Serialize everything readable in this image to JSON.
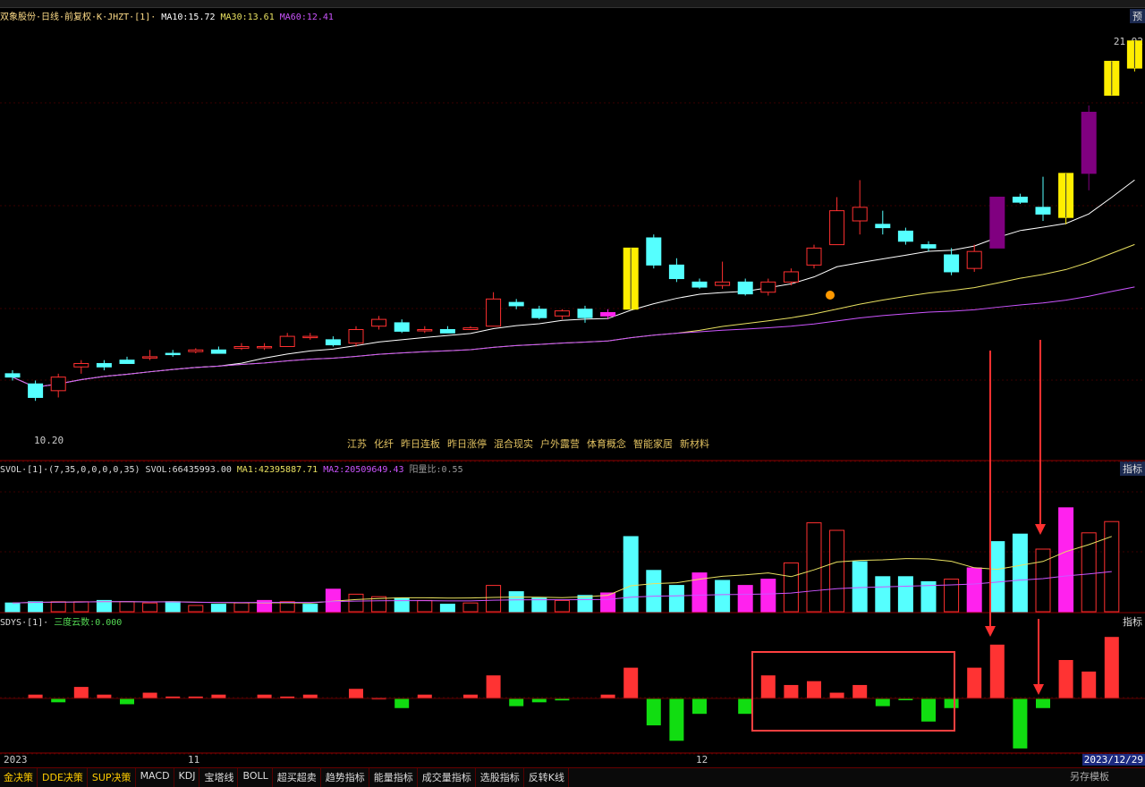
{
  "main_header": {
    "title": "双象股份·日线·前复权·K·JHZT·[1]·",
    "ma10": "MA10:15.72",
    "ma30": "MA30:13.61",
    "ma60": "MA60:12.41",
    "max_price": "21.92",
    "min_price": "10.20",
    "right_tag": "预"
  },
  "vol_header": {
    "title": "SVOL·[1]·(7,35,0,0,0,0,35)",
    "svol": "SVOL:66435993.00",
    "ma1": "MA1:42395887.71",
    "ma2": "MA2:20509649.43",
    "ratio": "阳量比:0.55",
    "right_tag": "指标"
  },
  "sdys_header": {
    "title": "SDYS·[1]·",
    "value": "三度云数:0.000",
    "right_tag": "指标"
  },
  "concepts": [
    "江苏",
    "化纤",
    "昨日连板",
    "昨日涨停",
    "混合现实",
    "户外露营",
    "体育概念",
    "智能家居",
    "新材料"
  ],
  "time_axis": {
    "year": "2023",
    "m11": "11",
    "m12": "12",
    "current_date": "2023/12/29"
  },
  "tabs": [
    "金决策",
    "DDE决策",
    "SUP决策",
    "MACD",
    "KDJ",
    "宝塔线",
    "BOLL",
    "超买超卖",
    "趋势指标",
    "能量指标",
    "成交量指标",
    "选股指标",
    "反转K线"
  ],
  "save_label": "另存模板",
  "colors": {
    "up": "#ff3030",
    "down": "#55ffff",
    "magenta": "#ff22ee",
    "yellow": "#ffee00",
    "purple": "#800080",
    "ma10": "#ffffff",
    "ma30": "#e8e060",
    "ma60": "#cc55ff",
    "arrow": "#ff3030"
  },
  "chart_data": {
    "type": "candlestick",
    "candles": [
      {
        "o": 12.1,
        "h": 12.2,
        "l": 11.9,
        "c": 12.0,
        "t": "down"
      },
      {
        "o": 11.8,
        "h": 11.9,
        "l": 11.3,
        "c": 11.4,
        "t": "down"
      },
      {
        "o": 11.6,
        "h": 12.1,
        "l": 11.4,
        "c": 12.0,
        "t": "up"
      },
      {
        "o": 12.4,
        "h": 12.5,
        "l": 12.1,
        "c": 12.3,
        "t": "up"
      },
      {
        "o": 12.3,
        "h": 12.5,
        "l": 12.2,
        "c": 12.4,
        "t": "down"
      },
      {
        "o": 12.5,
        "h": 12.6,
        "l": 12.4,
        "c": 12.4,
        "t": "down"
      },
      {
        "o": 12.6,
        "h": 12.8,
        "l": 12.5,
        "c": 12.6,
        "t": "up"
      },
      {
        "o": 12.7,
        "h": 12.8,
        "l": 12.6,
        "c": 12.7,
        "t": "down"
      },
      {
        "o": 12.8,
        "h": 12.85,
        "l": 12.7,
        "c": 12.75,
        "t": "up"
      },
      {
        "o": 12.8,
        "h": 12.9,
        "l": 12.7,
        "c": 12.7,
        "t": "down"
      },
      {
        "o": 12.9,
        "h": 13.0,
        "l": 12.8,
        "c": 12.85,
        "t": "up"
      },
      {
        "o": 12.9,
        "h": 13.0,
        "l": 12.8,
        "c": 12.9,
        "t": "up"
      },
      {
        "o": 12.9,
        "h": 13.3,
        "l": 12.9,
        "c": 13.2,
        "t": "up"
      },
      {
        "o": 13.2,
        "h": 13.3,
        "l": 13.1,
        "c": 13.2,
        "t": "up"
      },
      {
        "o": 13.1,
        "h": 13.2,
        "l": 12.9,
        "c": 12.95,
        "t": "down"
      },
      {
        "o": 13.0,
        "h": 13.5,
        "l": 12.9,
        "c": 13.4,
        "t": "up"
      },
      {
        "o": 13.5,
        "h": 13.8,
        "l": 13.4,
        "c": 13.7,
        "t": "up"
      },
      {
        "o": 13.6,
        "h": 13.7,
        "l": 13.3,
        "c": 13.35,
        "t": "down"
      },
      {
        "o": 13.4,
        "h": 13.5,
        "l": 13.3,
        "c": 13.4,
        "t": "up"
      },
      {
        "o": 13.4,
        "h": 13.5,
        "l": 13.3,
        "c": 13.3,
        "t": "down"
      },
      {
        "o": 13.4,
        "h": 13.5,
        "l": 13.4,
        "c": 13.45,
        "t": "up"
      },
      {
        "o": 13.5,
        "h": 14.5,
        "l": 13.5,
        "c": 14.3,
        "t": "up"
      },
      {
        "o": 14.2,
        "h": 14.3,
        "l": 14.0,
        "c": 14.1,
        "t": "down"
      },
      {
        "o": 14.0,
        "h": 14.1,
        "l": 13.7,
        "c": 13.75,
        "t": "down"
      },
      {
        "o": 13.8,
        "h": 14.0,
        "l": 13.7,
        "c": 13.95,
        "t": "up"
      },
      {
        "o": 14.0,
        "h": 14.1,
        "l": 13.6,
        "c": 13.75,
        "t": "down"
      },
      {
        "o": 13.8,
        "h": 14.0,
        "l": 13.7,
        "c": 13.9,
        "t": "magenta"
      },
      {
        "o": 14.0,
        "h": 15.8,
        "l": 14.0,
        "c": 15.8,
        "t": "yellow"
      },
      {
        "o": 16.1,
        "h": 16.2,
        "l": 15.2,
        "c": 15.3,
        "t": "down"
      },
      {
        "o": 15.3,
        "h": 15.5,
        "l": 14.8,
        "c": 14.9,
        "t": "down"
      },
      {
        "o": 14.8,
        "h": 14.9,
        "l": 14.6,
        "c": 14.65,
        "t": "down"
      },
      {
        "o": 14.7,
        "h": 15.4,
        "l": 14.6,
        "c": 14.8,
        "t": "up"
      },
      {
        "o": 14.8,
        "h": 14.9,
        "l": 14.4,
        "c": 14.45,
        "t": "down"
      },
      {
        "o": 14.5,
        "h": 14.9,
        "l": 14.4,
        "c": 14.8,
        "t": "up"
      },
      {
        "o": 14.8,
        "h": 15.2,
        "l": 14.7,
        "c": 15.1,
        "t": "up"
      },
      {
        "o": 15.3,
        "h": 15.9,
        "l": 15.2,
        "c": 15.8,
        "t": "up"
      },
      {
        "o": 15.9,
        "h": 17.3,
        "l": 15.9,
        "c": 16.9,
        "t": "up"
      },
      {
        "o": 16.6,
        "h": 17.8,
        "l": 16.2,
        "c": 17.0,
        "t": "up"
      },
      {
        "o": 16.5,
        "h": 16.9,
        "l": 16.2,
        "c": 16.4,
        "t": "down"
      },
      {
        "o": 16.3,
        "h": 16.4,
        "l": 15.9,
        "c": 16.0,
        "t": "down"
      },
      {
        "o": 15.9,
        "h": 16.0,
        "l": 15.7,
        "c": 15.8,
        "t": "down"
      },
      {
        "o": 15.6,
        "h": 15.8,
        "l": 15.0,
        "c": 15.1,
        "t": "down"
      },
      {
        "o": 15.2,
        "h": 15.9,
        "l": 15.1,
        "c": 15.7,
        "t": "up"
      },
      {
        "o": 15.8,
        "h": 17.3,
        "l": 15.8,
        "c": 17.3,
        "t": "purple"
      },
      {
        "o": 17.3,
        "h": 17.4,
        "l": 17.1,
        "c": 17.15,
        "t": "down"
      },
      {
        "o": 17.0,
        "h": 17.9,
        "l": 16.6,
        "c": 16.8,
        "t": "down"
      },
      {
        "o": 16.7,
        "h": 18.0,
        "l": 16.5,
        "c": 18.0,
        "t": "yellow"
      },
      {
        "o": 18.0,
        "h": 20.0,
        "l": 17.5,
        "c": 19.8,
        "t": "purple"
      },
      {
        "o": 20.3,
        "h": 21.3,
        "l": 20.3,
        "c": 21.3,
        "t": "yellow"
      },
      {
        "o": 21.9,
        "h": 21.9,
        "l": 21.0,
        "c": 21.1,
        "t": "yellow"
      }
    ],
    "volume": [
      {
        "v": 0.7,
        "t": "down"
      },
      {
        "v": 0.8,
        "t": "down"
      },
      {
        "v": 0.8,
        "t": "up"
      },
      {
        "v": 0.8,
        "t": "up"
      },
      {
        "v": 0.9,
        "t": "down"
      },
      {
        "v": 0.8,
        "t": "up"
      },
      {
        "v": 0.7,
        "t": "up"
      },
      {
        "v": 0.8,
        "t": "down"
      },
      {
        "v": 0.5,
        "t": "up"
      },
      {
        "v": 0.6,
        "t": "down"
      },
      {
        "v": 0.7,
        "t": "up"
      },
      {
        "v": 0.9,
        "t": "magenta"
      },
      {
        "v": 0.8,
        "t": "up"
      },
      {
        "v": 0.6,
        "t": "down"
      },
      {
        "v": 1.8,
        "t": "magenta"
      },
      {
        "v": 1.4,
        "t": "up"
      },
      {
        "v": 1.2,
        "t": "up"
      },
      {
        "v": 1.1,
        "t": "down"
      },
      {
        "v": 0.9,
        "t": "up"
      },
      {
        "v": 0.6,
        "t": "down"
      },
      {
        "v": 0.7,
        "t": "up"
      },
      {
        "v": 2.1,
        "t": "up"
      },
      {
        "v": 1.6,
        "t": "down"
      },
      {
        "v": 1.1,
        "t": "down"
      },
      {
        "v": 0.9,
        "t": "up"
      },
      {
        "v": 1.3,
        "t": "down"
      },
      {
        "v": 1.5,
        "t": "magenta"
      },
      {
        "v": 6.0,
        "t": "down"
      },
      {
        "v": 3.3,
        "t": "down"
      },
      {
        "v": 2.1,
        "t": "down"
      },
      {
        "v": 3.1,
        "t": "magenta"
      },
      {
        "v": 2.5,
        "t": "down"
      },
      {
        "v": 2.1,
        "t": "magenta"
      },
      {
        "v": 2.6,
        "t": "magenta"
      },
      {
        "v": 3.9,
        "t": "up"
      },
      {
        "v": 7.1,
        "t": "up"
      },
      {
        "v": 6.5,
        "t": "up"
      },
      {
        "v": 4.0,
        "t": "down"
      },
      {
        "v": 2.8,
        "t": "down"
      },
      {
        "v": 2.8,
        "t": "down"
      },
      {
        "v": 2.4,
        "t": "down"
      },
      {
        "v": 2.6,
        "t": "up"
      },
      {
        "v": 3.5,
        "t": "magenta"
      },
      {
        "v": 5.6,
        "t": "down"
      },
      {
        "v": 6.2,
        "t": "down"
      },
      {
        "v": 5.0,
        "t": "up"
      },
      {
        "v": 8.3,
        "t": "magenta"
      },
      {
        "v": 6.3,
        "t": "up"
      },
      {
        "v": 7.2,
        "t": "up"
      }
    ],
    "sdys": [
      0,
      0.1,
      -0.1,
      0.3,
      0.1,
      -0.15,
      0.15,
      0.05,
      0.05,
      0.1,
      0,
      0.1,
      0.05,
      0.1,
      0,
      0.25,
      0.02,
      -0.25,
      0.1,
      0,
      0.1,
      0.6,
      -0.2,
      -0.1,
      -0.05,
      0,
      0.1,
      0.8,
      -0.7,
      -1.1,
      -0.4,
      0,
      -0.4,
      0.6,
      0.35,
      0.45,
      0.15,
      0.35,
      -0.2,
      -0.02,
      -0.6,
      -0.25,
      0.8,
      1.4,
      -1.3,
      -0.25,
      1.0,
      0.7,
      1.6
    ]
  }
}
